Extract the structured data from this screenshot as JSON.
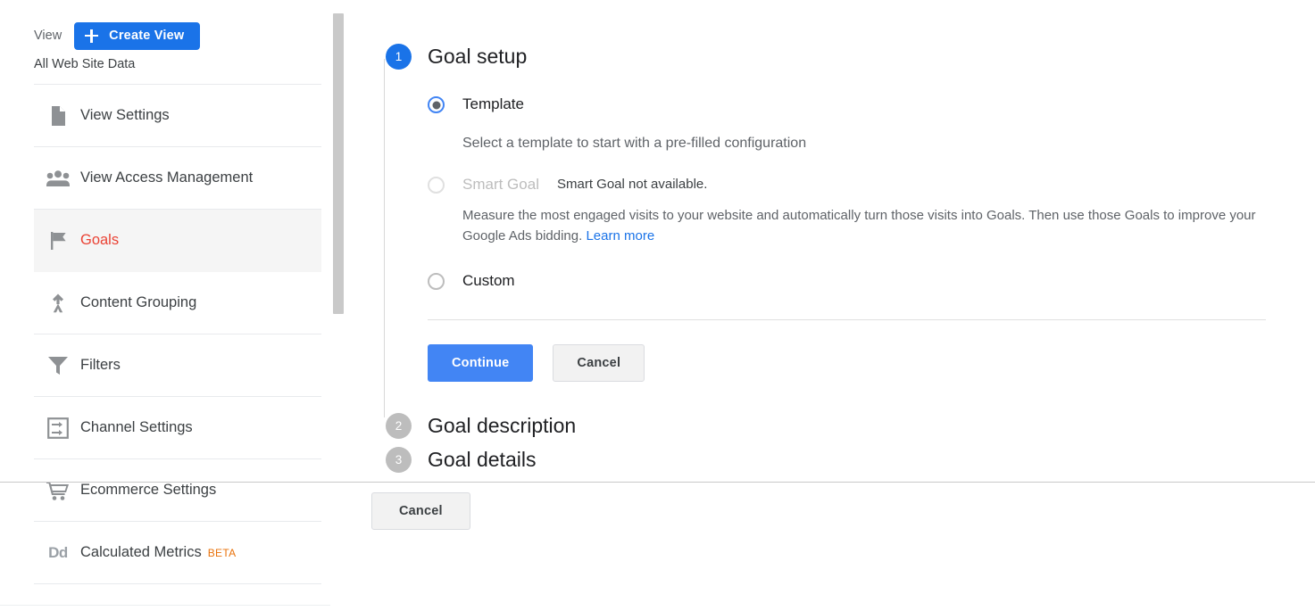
{
  "sidebar": {
    "view_label": "View",
    "create_view_button": "Create View",
    "create_view_icon": "plus-icon",
    "view_name": "All Web Site Data",
    "items": [
      {
        "label": "View Settings",
        "icon": "document-icon",
        "active": false,
        "badge": ""
      },
      {
        "label": "View Access Management",
        "icon": "people-group-icon",
        "active": false,
        "badge": ""
      },
      {
        "label": "Goals",
        "icon": "flag-icon",
        "active": true,
        "badge": ""
      },
      {
        "label": "Content Grouping",
        "icon": "content-grouping-icon",
        "active": false,
        "badge": ""
      },
      {
        "label": "Filters",
        "icon": "funnel-icon",
        "active": false,
        "badge": ""
      },
      {
        "label": "Channel Settings",
        "icon": "channel-settings-icon",
        "active": false,
        "badge": ""
      },
      {
        "label": "Ecommerce Settings",
        "icon": "shopping-cart-icon",
        "active": false,
        "badge": ""
      },
      {
        "label": "Calculated Metrics",
        "icon": "dd-icon",
        "active": false,
        "badge": "BETA"
      }
    ],
    "collapse_tab_icon": "chevron-right-icon"
  },
  "wizard": {
    "step1": {
      "number": "1",
      "title": "Goal setup",
      "template": {
        "label": "Template",
        "selected": true,
        "helper": "Select a template to start with a pre-filled configuration"
      },
      "smart_goal": {
        "label": "Smart Goal",
        "selected": false,
        "disabled": true,
        "note": "Smart Goal not available.",
        "description": "Measure the most engaged visits to your website and automatically turn those visits into Goals. Then use those Goals to improve your Google Ads bidding.",
        "learn_more": "Learn more"
      },
      "custom": {
        "label": "Custom",
        "selected": false
      },
      "continue_button": "Continue",
      "cancel_button": "Cancel"
    },
    "step2": {
      "number": "2",
      "title": "Goal description"
    },
    "step3": {
      "number": "3",
      "title": "Goal details"
    },
    "footer_cancel_button": "Cancel"
  },
  "colors": {
    "brand_blue": "#1a73e8",
    "button_blue": "#4285f4",
    "active_red": "#ea4335",
    "beta_orange": "#e8710a",
    "step_pending_gray": "#bdbdbd"
  }
}
